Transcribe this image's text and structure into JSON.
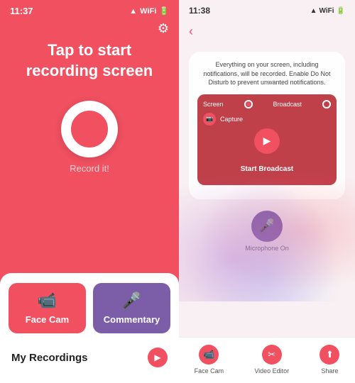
{
  "left": {
    "statusBar": {
      "time": "11:37",
      "icons": "▲ WiFi 🔋"
    },
    "title": "Tap to start\nrecording screen",
    "recordLabel": "Record it!",
    "gearIcon": "⚙",
    "buttons": {
      "faceCam": "Face Cam",
      "commentary": "Commentary"
    },
    "recordings": {
      "label": "My Recordings"
    }
  },
  "right": {
    "statusBar": {
      "time": "11:38",
      "icons": "▲ WiFi 🔋"
    },
    "backIcon": "‹",
    "broadcastDialog": {
      "notice": "Everything on your screen, including notifications, will be recorded. Enable Do Not Disturb to prevent unwanted notifications.",
      "option1": "Screen",
      "option2": "Broadcast",
      "startLabel": "Start Broadcast"
    },
    "micLabel": "Microphone\nOn",
    "navItems": [
      {
        "label": "Face Cam",
        "icon": "📹"
      },
      {
        "label": "Video Editor",
        "icon": "✂"
      },
      {
        "label": "Share",
        "icon": "⬆"
      }
    ]
  }
}
